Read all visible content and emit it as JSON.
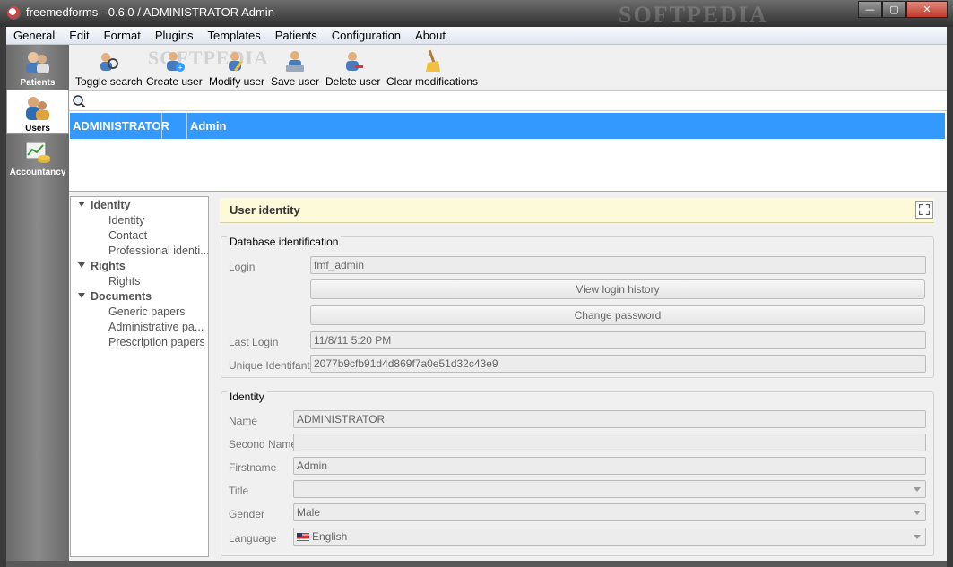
{
  "window": {
    "title": "freemedforms - 0.6.0 /  ADMINISTRATOR Admin",
    "watermark": "SOFTPEDIA",
    "minimize": "—",
    "maximize": "▢",
    "close": "✕"
  },
  "menu": [
    "General",
    "Edit",
    "Format",
    "Plugins",
    "Templates",
    "Patients",
    "Configuration",
    "About"
  ],
  "modes": [
    {
      "label": "Patients",
      "icon": "patients-icon",
      "active": false
    },
    {
      "label": "Users",
      "icon": "users-icon",
      "active": true
    },
    {
      "label": "Accountancy",
      "icon": "accountancy-icon",
      "active": false
    }
  ],
  "toolbar": {
    "watermark": "SOFTPEDIA",
    "buttons": [
      {
        "label": "Toggle search",
        "icon": "toggle-search-icon"
      },
      {
        "label": "Create user",
        "icon": "create-user-icon"
      },
      {
        "label": "Modify user",
        "icon": "modify-user-icon"
      },
      {
        "label": "Save user",
        "icon": "save-user-icon"
      },
      {
        "label": "Delete user",
        "icon": "delete-user-icon"
      },
      {
        "label": "Clear modifications",
        "icon": "clear-icon"
      }
    ]
  },
  "users_table": {
    "rows": [
      {
        "name": "ADMINISTRATOR",
        "empty": "",
        "firstname": "Admin",
        "selected": true
      }
    ]
  },
  "tree": [
    {
      "label": "Identity",
      "type": "parent"
    },
    {
      "label": "Identity",
      "type": "child"
    },
    {
      "label": "Contact",
      "type": "child"
    },
    {
      "label": "Professional identi...",
      "type": "child"
    },
    {
      "label": "Rights",
      "type": "parent"
    },
    {
      "label": "Rights",
      "type": "child"
    },
    {
      "label": "Documents",
      "type": "parent"
    },
    {
      "label": "Generic papers",
      "type": "child"
    },
    {
      "label": "Administrative pa...",
      "type": "child"
    },
    {
      "label": "Prescription papers",
      "type": "child"
    }
  ],
  "panel": {
    "title": "User identity",
    "database_group": {
      "title": "Database identification",
      "login_label": "Login",
      "login_value": "fmf_admin",
      "history_button": "View login history",
      "password_button": "Change password",
      "last_login_label": "Last Login",
      "last_login_value": "11/8/11 5:20 PM",
      "uid_label": "Unique Identifant",
      "uid_value": "2077b9cfb91d4d869f7a0e51d32c43e9"
    },
    "identity_group": {
      "title": "Identity",
      "name_label": "Name",
      "name_value": "ADMINISTRATOR",
      "second_name_label": "Second Name",
      "second_name_value": "",
      "firstname_label": "Firstname",
      "firstname_value": "Admin",
      "title_label": "Title",
      "title_value": "",
      "gender_label": "Gender",
      "gender_value": "Male",
      "language_label": "Language",
      "language_value": "English"
    }
  }
}
